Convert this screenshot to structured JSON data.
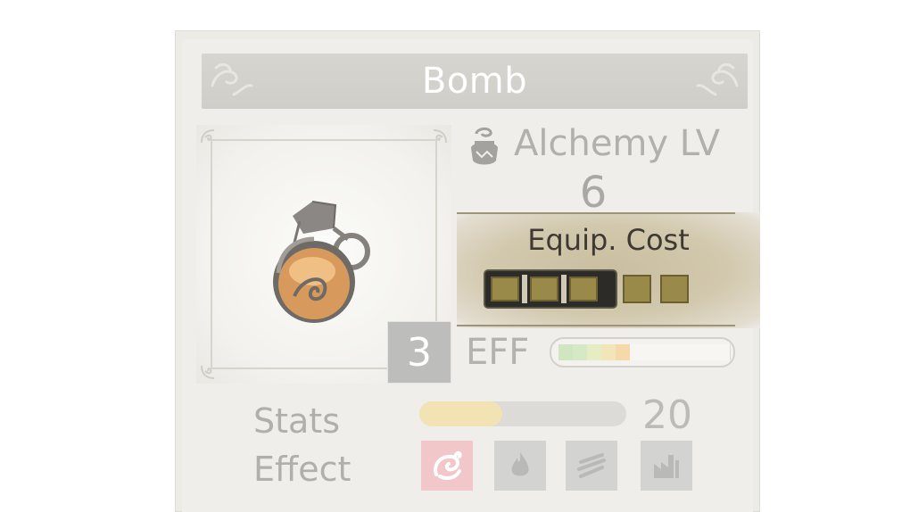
{
  "item": {
    "name": "Bomb",
    "level_badge": "3",
    "icon": "bomb-icon"
  },
  "alchemy": {
    "label": "Alchemy LV",
    "value": "6",
    "icon": "alchemy-pot-icon"
  },
  "equip_cost": {
    "title": "Equip. Cost",
    "used_slots": 3,
    "total_slots": 5
  },
  "eff": {
    "label": "EFF",
    "segments_total": 12,
    "segments_filled": 5,
    "segment_colors": [
      "#cfe6c0",
      "#d6e9c4",
      "#e6edc4",
      "#f1e6b8",
      "#f6d9a8"
    ]
  },
  "stats": {
    "label": "Stats",
    "value": "20",
    "fill_fraction": 0.4
  },
  "effect": {
    "label": "Effect",
    "icons": [
      {
        "name": "fire-swirl-icon",
        "active": true,
        "color": "#f1c7c9"
      },
      {
        "name": "flame-icon",
        "active": false,
        "color": "#d3d3d1"
      },
      {
        "name": "wind-lines-icon",
        "active": false,
        "color": "#d3d3d1"
      },
      {
        "name": "factory-icon",
        "active": false,
        "color": "#d3d3d1"
      }
    ]
  },
  "colors": {
    "title_bar": "#d2d1cb",
    "cost_panel": "#c9bea0",
    "slot_fill": "#9a8a4a"
  }
}
